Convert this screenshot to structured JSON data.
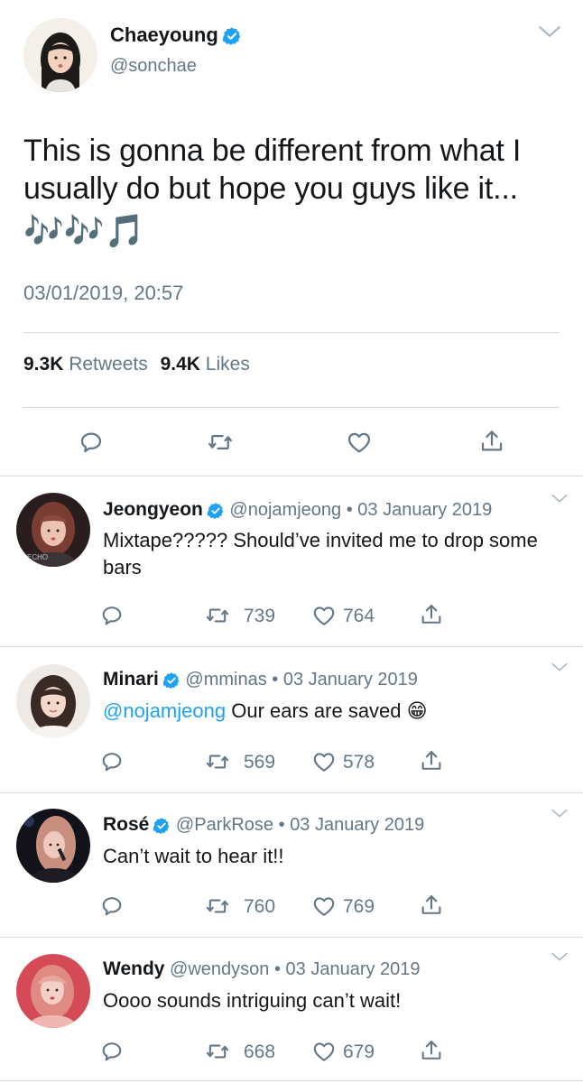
{
  "main_tweet": {
    "name": "Chaeyoung",
    "handle": "@sonchae",
    "text": "This is gonna be different from what I usually do but hope you guys like it...",
    "music_glyphs": "🎶🎶🎵",
    "timestamp": "03/01/2019, 20:57",
    "retweets_count": "9.3K",
    "retweets_label": "Retweets",
    "likes_count": "9.4K",
    "likes_label": "Likes"
  },
  "replies": [
    {
      "name": "Jeongyeon",
      "handle": "@nojamjeong",
      "sep": "•",
      "date": "03 January 2019",
      "mention": "",
      "text": "Mixtape????? Should’ve invited me to drop some bars",
      "retweets": "739",
      "likes": "764"
    },
    {
      "name": "Minari",
      "handle": "@mminas",
      "sep": "•",
      "date": "03 January 2019",
      "mention": "@nojamjeong",
      "text": "Our ears are saved 😁",
      "retweets": "569",
      "likes": "578"
    },
    {
      "name": "Rosé",
      "handle": "@ParkRose",
      "sep": "•",
      "date": "03 January 2019",
      "mention": "",
      "text": "Can’t wait to hear it!!",
      "retweets": "760",
      "likes": "769"
    },
    {
      "name": "Wendy",
      "handle": "@wendyson",
      "sep": "•",
      "date": "03 January 2019",
      "mention": "",
      "text": "Oooo sounds intriguing can’t wait!",
      "retweets": "668",
      "likes": "679"
    }
  ],
  "colors": {
    "accent": "#1da1f2",
    "muted": "#657786",
    "divider": "#d6dbe0"
  }
}
